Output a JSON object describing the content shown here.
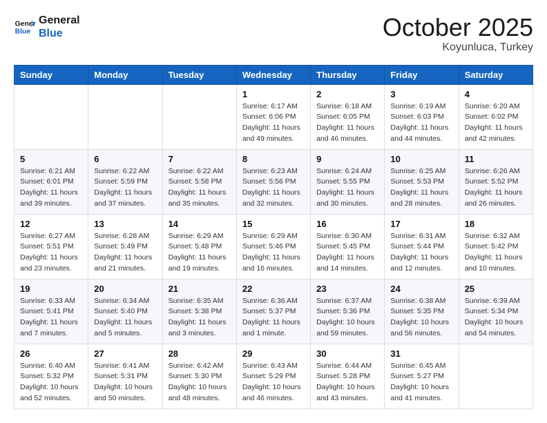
{
  "logo": {
    "line1": "General",
    "line2": "Blue"
  },
  "header": {
    "month": "October 2025",
    "location": "Koyunluca, Turkey"
  },
  "weekdays": [
    "Sunday",
    "Monday",
    "Tuesday",
    "Wednesday",
    "Thursday",
    "Friday",
    "Saturday"
  ],
  "weeks": [
    [
      {
        "day": "",
        "info": ""
      },
      {
        "day": "",
        "info": ""
      },
      {
        "day": "",
        "info": ""
      },
      {
        "day": "1",
        "info": "Sunrise: 6:17 AM\nSunset: 6:06 PM\nDaylight: 11 hours\nand 49 minutes."
      },
      {
        "day": "2",
        "info": "Sunrise: 6:18 AM\nSunset: 6:05 PM\nDaylight: 11 hours\nand 46 minutes."
      },
      {
        "day": "3",
        "info": "Sunrise: 6:19 AM\nSunset: 6:03 PM\nDaylight: 11 hours\nand 44 minutes."
      },
      {
        "day": "4",
        "info": "Sunrise: 6:20 AM\nSunset: 6:02 PM\nDaylight: 11 hours\nand 42 minutes."
      }
    ],
    [
      {
        "day": "5",
        "info": "Sunrise: 6:21 AM\nSunset: 6:01 PM\nDaylight: 11 hours\nand 39 minutes."
      },
      {
        "day": "6",
        "info": "Sunrise: 6:22 AM\nSunset: 5:59 PM\nDaylight: 11 hours\nand 37 minutes."
      },
      {
        "day": "7",
        "info": "Sunrise: 6:22 AM\nSunset: 5:58 PM\nDaylight: 11 hours\nand 35 minutes."
      },
      {
        "day": "8",
        "info": "Sunrise: 6:23 AM\nSunset: 5:56 PM\nDaylight: 11 hours\nand 32 minutes."
      },
      {
        "day": "9",
        "info": "Sunrise: 6:24 AM\nSunset: 5:55 PM\nDaylight: 11 hours\nand 30 minutes."
      },
      {
        "day": "10",
        "info": "Sunrise: 6:25 AM\nSunset: 5:53 PM\nDaylight: 11 hours\nand 28 minutes."
      },
      {
        "day": "11",
        "info": "Sunrise: 6:26 AM\nSunset: 5:52 PM\nDaylight: 11 hours\nand 26 minutes."
      }
    ],
    [
      {
        "day": "12",
        "info": "Sunrise: 6:27 AM\nSunset: 5:51 PM\nDaylight: 11 hours\nand 23 minutes."
      },
      {
        "day": "13",
        "info": "Sunrise: 6:28 AM\nSunset: 5:49 PM\nDaylight: 11 hours\nand 21 minutes."
      },
      {
        "day": "14",
        "info": "Sunrise: 6:29 AM\nSunset: 5:48 PM\nDaylight: 11 hours\nand 19 minutes."
      },
      {
        "day": "15",
        "info": "Sunrise: 6:29 AM\nSunset: 5:46 PM\nDaylight: 11 hours\nand 16 minutes."
      },
      {
        "day": "16",
        "info": "Sunrise: 6:30 AM\nSunset: 5:45 PM\nDaylight: 11 hours\nand 14 minutes."
      },
      {
        "day": "17",
        "info": "Sunrise: 6:31 AM\nSunset: 5:44 PM\nDaylight: 11 hours\nand 12 minutes."
      },
      {
        "day": "18",
        "info": "Sunrise: 6:32 AM\nSunset: 5:42 PM\nDaylight: 11 hours\nand 10 minutes."
      }
    ],
    [
      {
        "day": "19",
        "info": "Sunrise: 6:33 AM\nSunset: 5:41 PM\nDaylight: 11 hours\nand 7 minutes."
      },
      {
        "day": "20",
        "info": "Sunrise: 6:34 AM\nSunset: 5:40 PM\nDaylight: 11 hours\nand 5 minutes."
      },
      {
        "day": "21",
        "info": "Sunrise: 6:35 AM\nSunset: 5:38 PM\nDaylight: 11 hours\nand 3 minutes."
      },
      {
        "day": "22",
        "info": "Sunrise: 6:36 AM\nSunset: 5:37 PM\nDaylight: 11 hours\nand 1 minute."
      },
      {
        "day": "23",
        "info": "Sunrise: 6:37 AM\nSunset: 5:36 PM\nDaylight: 10 hours\nand 59 minutes."
      },
      {
        "day": "24",
        "info": "Sunrise: 6:38 AM\nSunset: 5:35 PM\nDaylight: 10 hours\nand 56 minutes."
      },
      {
        "day": "25",
        "info": "Sunrise: 6:39 AM\nSunset: 5:34 PM\nDaylight: 10 hours\nand 54 minutes."
      }
    ],
    [
      {
        "day": "26",
        "info": "Sunrise: 6:40 AM\nSunset: 5:32 PM\nDaylight: 10 hours\nand 52 minutes."
      },
      {
        "day": "27",
        "info": "Sunrise: 6:41 AM\nSunset: 5:31 PM\nDaylight: 10 hours\nand 50 minutes."
      },
      {
        "day": "28",
        "info": "Sunrise: 6:42 AM\nSunset: 5:30 PM\nDaylight: 10 hours\nand 48 minutes."
      },
      {
        "day": "29",
        "info": "Sunrise: 6:43 AM\nSunset: 5:29 PM\nDaylight: 10 hours\nand 46 minutes."
      },
      {
        "day": "30",
        "info": "Sunrise: 6:44 AM\nSunset: 5:28 PM\nDaylight: 10 hours\nand 43 minutes."
      },
      {
        "day": "31",
        "info": "Sunrise: 6:45 AM\nSunset: 5:27 PM\nDaylight: 10 hours\nand 41 minutes."
      },
      {
        "day": "",
        "info": ""
      }
    ]
  ]
}
